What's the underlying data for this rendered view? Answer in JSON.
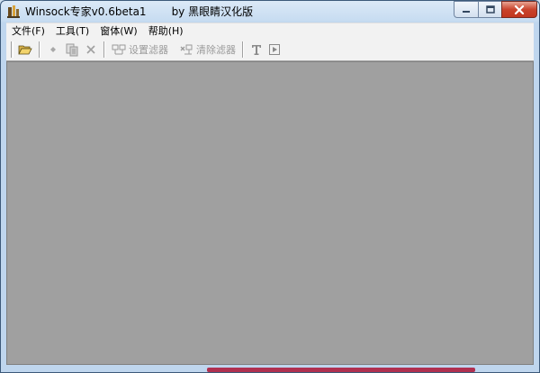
{
  "window": {
    "title": "Winsock专家v0.6beta1",
    "title_suffix": "by 黑眼睛汉化版"
  },
  "menu": {
    "items": [
      {
        "label": "文件(F)"
      },
      {
        "label": "工具(T)"
      },
      {
        "label": "窗体(W)"
      },
      {
        "label": "帮助(H)"
      }
    ]
  },
  "toolbar": {
    "open_icon": "folder-open-icon",
    "set_filter_label": "设置滤器",
    "clear_filter_label": "清除滤器"
  },
  "colors": {
    "client_background": "#a0a0a0",
    "close_button": "#c9432c"
  }
}
